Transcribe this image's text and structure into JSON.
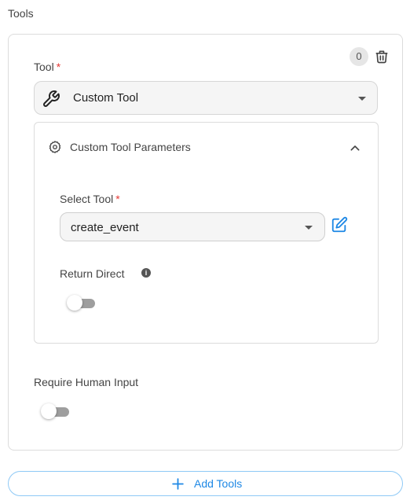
{
  "section": {
    "title": "Tools"
  },
  "tool_entry": {
    "index": "0",
    "tool_label": "Tool",
    "required_marker": "*",
    "tool_value": "Custom Tool",
    "params_panel": {
      "title": "Custom Tool Parameters",
      "select_tool_label": "Select Tool",
      "select_tool_value": "create_event",
      "return_direct_label": "Return Direct",
      "return_direct_on": false
    },
    "require_human_label": "Require Human Input",
    "require_human_on": false
  },
  "add_button": {
    "label": "Add Tools"
  },
  "colors": {
    "accent": "#1e88e5",
    "required": "#e53935",
    "border": "#dcdcdc",
    "toggle_off": "#9e9e9e"
  },
  "icons": [
    "trash-icon",
    "wrench-icon",
    "gear-icon",
    "chevron-up-icon",
    "edit-icon",
    "info-icon",
    "plus-icon",
    "caret-down-icon"
  ]
}
